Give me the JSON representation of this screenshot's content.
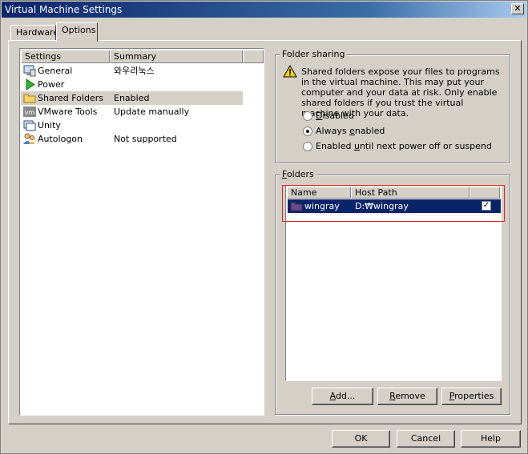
{
  "window": {
    "title": "Virtual Machine Settings",
    "close_glyph": "✕"
  },
  "tabs": [
    {
      "label": "Hardware",
      "active": false
    },
    {
      "label": "Options",
      "active": true
    }
  ],
  "settings_list": {
    "columns": [
      "Settings",
      "Summary"
    ],
    "rows": [
      {
        "name": "General",
        "summary": "와우리눅스",
        "icon": "computer-icon"
      },
      {
        "name": "Power",
        "summary": "",
        "icon": "play-icon"
      },
      {
        "name": "Shared Folders",
        "summary": "Enabled",
        "icon": "folder-icon",
        "selected": true
      },
      {
        "name": "VMware Tools",
        "summary": "Update manually",
        "icon": "vm-icon"
      },
      {
        "name": "Unity",
        "summary": "",
        "icon": "unity-icon"
      },
      {
        "name": "Autologon",
        "summary": "Not supported",
        "icon": "users-icon"
      }
    ]
  },
  "folder_sharing": {
    "title": "Folder sharing",
    "warning": "Shared folders expose your files to programs in the virtual machine. This may put your computer and your data at risk. Only enable shared folders if you trust the virtual machine with your data.",
    "options": [
      {
        "label": "Disabled",
        "checked": false
      },
      {
        "label": "Always enabled",
        "checked": true
      },
      {
        "label": "Enabled until next power off or suspend",
        "checked": false
      }
    ]
  },
  "folders": {
    "title": "Folders",
    "columns": [
      "Name",
      "Host Path"
    ],
    "rows": [
      {
        "name": "wingray",
        "host_path": "D:₩wingray",
        "enabled": true
      }
    ],
    "buttons": {
      "add": "Add...",
      "remove": "Remove",
      "properties": "Properties"
    }
  },
  "footer": {
    "ok": "OK",
    "cancel": "Cancel",
    "help": "Help"
  }
}
